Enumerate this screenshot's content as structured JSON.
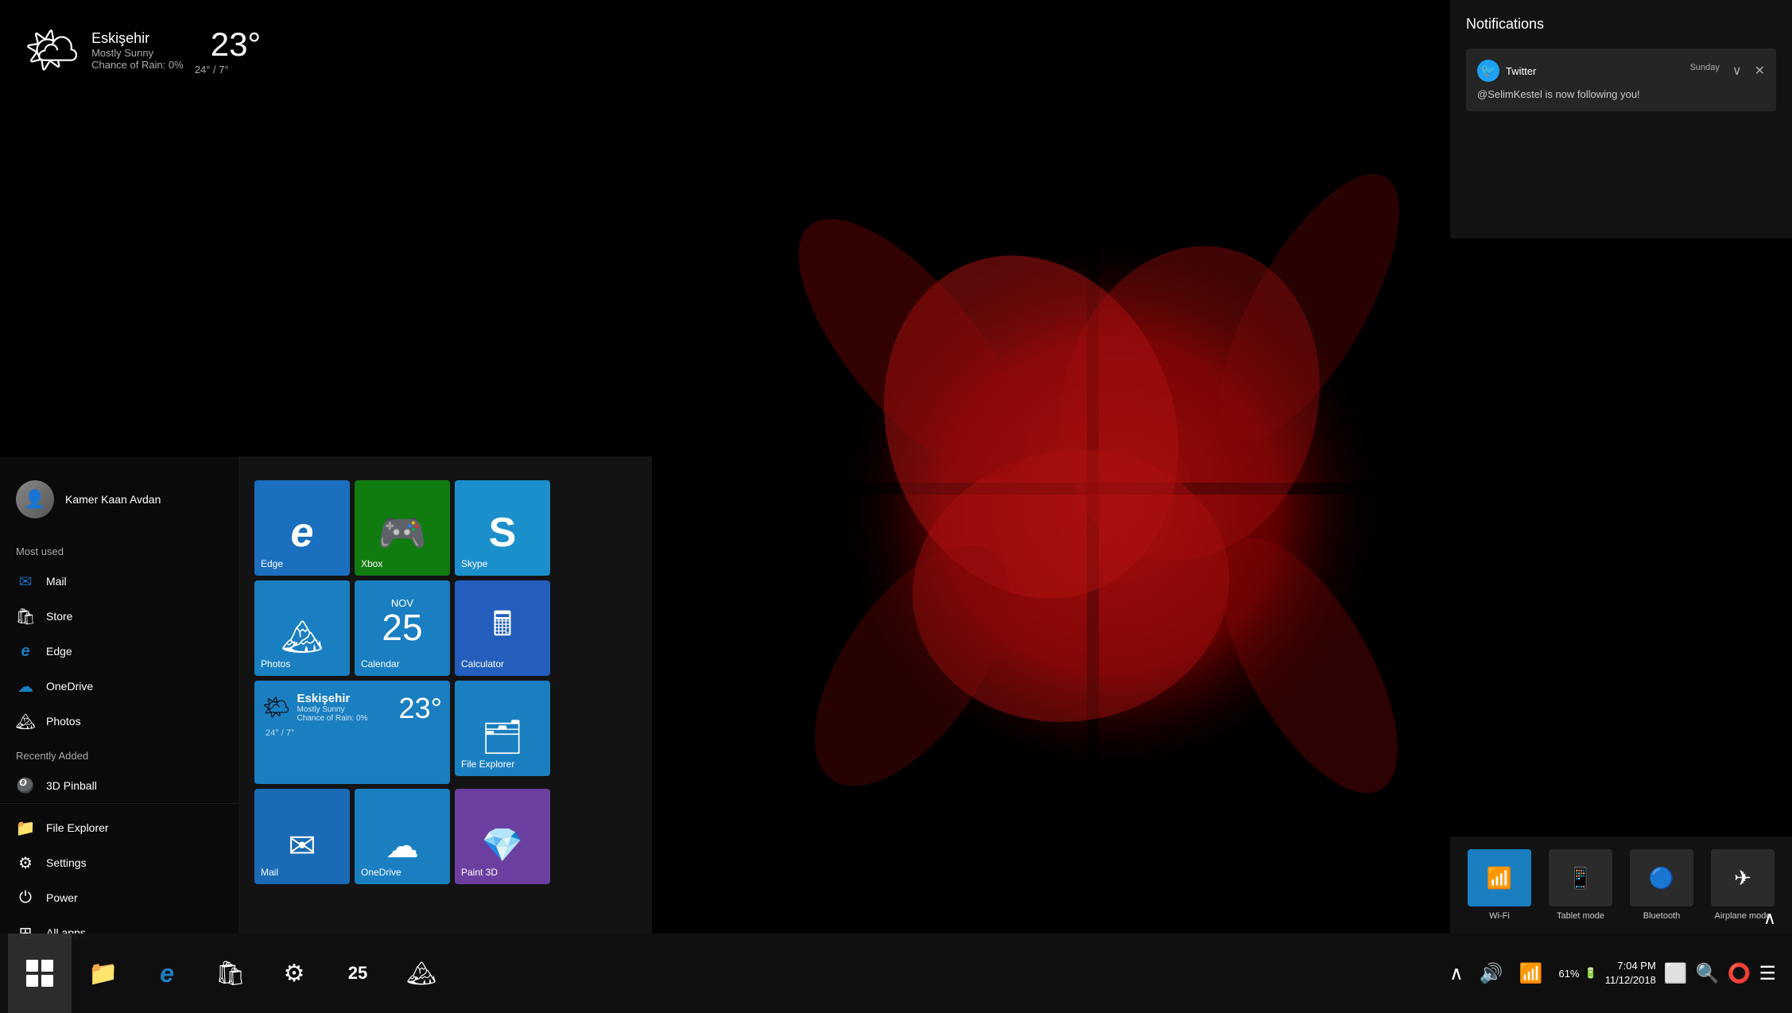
{
  "desktop": {
    "bg_color": "#000000"
  },
  "weather_widget": {
    "location": "Eskişehir",
    "condition": "Mostly Sunny",
    "rain": "Chance of Rain: 0%",
    "temperature": "23°",
    "range": "24° / 7°"
  },
  "start_menu": {
    "user": {
      "name": "Kamer Kaan Avdan"
    },
    "sections": {
      "most_used": "Most used",
      "recently_added": "Recently Added"
    },
    "apps": [
      {
        "name": "Mail",
        "icon": "✉"
      },
      {
        "name": "Store",
        "icon": "🏬"
      },
      {
        "name": "Edge",
        "icon": "🌐"
      },
      {
        "name": "OneDrive",
        "icon": "☁"
      },
      {
        "name": "Photos",
        "icon": "🏔"
      }
    ],
    "recently_added": [
      {
        "name": "3D Pinball",
        "icon": "🎱"
      }
    ],
    "bottom": [
      {
        "name": "File Explorer",
        "icon": "📁"
      },
      {
        "name": "Settings",
        "icon": "⚙"
      },
      {
        "name": "Power",
        "icon": "⏻"
      },
      {
        "name": "All apps",
        "icon": "⊞"
      }
    ]
  },
  "tiles": {
    "row1": [
      {
        "id": "edge",
        "label": "Edge",
        "color": "#1a6fbe",
        "icon": "e"
      },
      {
        "id": "xbox",
        "label": "Xbox",
        "color": "#107c10",
        "icon": "⊡"
      },
      {
        "id": "skype",
        "label": "Skype",
        "color": "#1a8fcc",
        "icon": "S"
      }
    ],
    "row2": [
      {
        "id": "photos",
        "label": "Photos",
        "color": "#1a7fc1",
        "icon": "🏔"
      },
      {
        "id": "calendar",
        "label": "Calendar",
        "color": "#1a7fc1",
        "icon": "📅",
        "day": "25"
      },
      {
        "id": "calculator",
        "label": "Calculator",
        "color": "#235ebc",
        "icon": "🔢"
      }
    ],
    "row3": [
      {
        "id": "weather",
        "label": "Eskişehir",
        "color": "#1a7fc1",
        "temp": "23°",
        "cond": "Mostly Sunny",
        "rain": "Chance of Rain: 0%",
        "range": "24° / 7°"
      },
      {
        "id": "fileexplorer",
        "label": "File Explorer",
        "color": "#1a7fc1",
        "icon": "🗂"
      }
    ],
    "row4": [
      {
        "id": "mail",
        "label": "Mail",
        "color": "#1a6ab5",
        "icon": "✉"
      },
      {
        "id": "onedrive",
        "label": "OneDrive",
        "color": "#1a7fc1",
        "icon": "☁"
      },
      {
        "id": "paint3d",
        "label": "Paint 3D",
        "color": "#6b3fa0",
        "icon": "💎"
      }
    ]
  },
  "notifications": {
    "title": "Notifications",
    "cards": [
      {
        "app": "Twitter",
        "app_icon": "🐦",
        "time": "Sunday",
        "message": "@SelimKestel is now following you!"
      }
    ]
  },
  "quick_actions": [
    {
      "id": "wifi",
      "label": "Wi-Fi",
      "icon": "📶",
      "active": true
    },
    {
      "id": "tablet",
      "label": "Tablet mode",
      "icon": "📱",
      "active": false
    },
    {
      "id": "bluetooth",
      "label": "Bluetooth",
      "icon": "🔵",
      "active": false
    },
    {
      "id": "airplane",
      "label": "Airplane mode",
      "icon": "✈",
      "active": false
    }
  ],
  "taskbar": {
    "start_icon": "⊞",
    "search_icon": "🔍",
    "cortana_icon": "⭕",
    "task_view": "🗔",
    "apps": [
      {
        "name": "windows-start",
        "icon": "⊞"
      },
      {
        "name": "file-explorer",
        "icon": "📁"
      },
      {
        "name": "edge",
        "icon": "e"
      },
      {
        "name": "store",
        "icon": "🛍"
      },
      {
        "name": "settings",
        "icon": "⚙"
      },
      {
        "name": "calendar-taskbar",
        "icon": "25"
      },
      {
        "name": "photos-taskbar",
        "icon": "🏔"
      }
    ],
    "system": {
      "battery_pct": "61%",
      "time": "7:04 PM",
      "date": "11/12/2018"
    }
  }
}
